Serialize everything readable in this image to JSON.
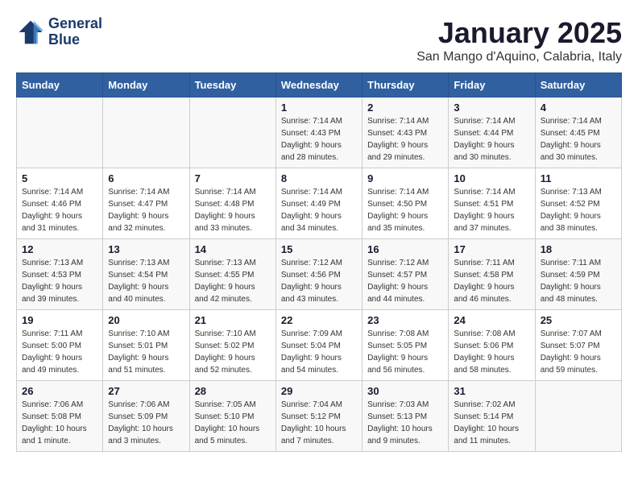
{
  "header": {
    "logo_line1": "General",
    "logo_line2": "Blue",
    "month": "January 2025",
    "location": "San Mango d'Aquino, Calabria, Italy"
  },
  "days_of_week": [
    "Sunday",
    "Monday",
    "Tuesday",
    "Wednesday",
    "Thursday",
    "Friday",
    "Saturday"
  ],
  "weeks": [
    [
      {
        "day": "",
        "info": ""
      },
      {
        "day": "",
        "info": ""
      },
      {
        "day": "",
        "info": ""
      },
      {
        "day": "1",
        "info": "Sunrise: 7:14 AM\nSunset: 4:43 PM\nDaylight: 9 hours\nand 28 minutes."
      },
      {
        "day": "2",
        "info": "Sunrise: 7:14 AM\nSunset: 4:43 PM\nDaylight: 9 hours\nand 29 minutes."
      },
      {
        "day": "3",
        "info": "Sunrise: 7:14 AM\nSunset: 4:44 PM\nDaylight: 9 hours\nand 30 minutes."
      },
      {
        "day": "4",
        "info": "Sunrise: 7:14 AM\nSunset: 4:45 PM\nDaylight: 9 hours\nand 30 minutes."
      }
    ],
    [
      {
        "day": "5",
        "info": "Sunrise: 7:14 AM\nSunset: 4:46 PM\nDaylight: 9 hours\nand 31 minutes."
      },
      {
        "day": "6",
        "info": "Sunrise: 7:14 AM\nSunset: 4:47 PM\nDaylight: 9 hours\nand 32 minutes."
      },
      {
        "day": "7",
        "info": "Sunrise: 7:14 AM\nSunset: 4:48 PM\nDaylight: 9 hours\nand 33 minutes."
      },
      {
        "day": "8",
        "info": "Sunrise: 7:14 AM\nSunset: 4:49 PM\nDaylight: 9 hours\nand 34 minutes."
      },
      {
        "day": "9",
        "info": "Sunrise: 7:14 AM\nSunset: 4:50 PM\nDaylight: 9 hours\nand 35 minutes."
      },
      {
        "day": "10",
        "info": "Sunrise: 7:14 AM\nSunset: 4:51 PM\nDaylight: 9 hours\nand 37 minutes."
      },
      {
        "day": "11",
        "info": "Sunrise: 7:13 AM\nSunset: 4:52 PM\nDaylight: 9 hours\nand 38 minutes."
      }
    ],
    [
      {
        "day": "12",
        "info": "Sunrise: 7:13 AM\nSunset: 4:53 PM\nDaylight: 9 hours\nand 39 minutes."
      },
      {
        "day": "13",
        "info": "Sunrise: 7:13 AM\nSunset: 4:54 PM\nDaylight: 9 hours\nand 40 minutes."
      },
      {
        "day": "14",
        "info": "Sunrise: 7:13 AM\nSunset: 4:55 PM\nDaylight: 9 hours\nand 42 minutes."
      },
      {
        "day": "15",
        "info": "Sunrise: 7:12 AM\nSunset: 4:56 PM\nDaylight: 9 hours\nand 43 minutes."
      },
      {
        "day": "16",
        "info": "Sunrise: 7:12 AM\nSunset: 4:57 PM\nDaylight: 9 hours\nand 44 minutes."
      },
      {
        "day": "17",
        "info": "Sunrise: 7:11 AM\nSunset: 4:58 PM\nDaylight: 9 hours\nand 46 minutes."
      },
      {
        "day": "18",
        "info": "Sunrise: 7:11 AM\nSunset: 4:59 PM\nDaylight: 9 hours\nand 48 minutes."
      }
    ],
    [
      {
        "day": "19",
        "info": "Sunrise: 7:11 AM\nSunset: 5:00 PM\nDaylight: 9 hours\nand 49 minutes."
      },
      {
        "day": "20",
        "info": "Sunrise: 7:10 AM\nSunset: 5:01 PM\nDaylight: 9 hours\nand 51 minutes."
      },
      {
        "day": "21",
        "info": "Sunrise: 7:10 AM\nSunset: 5:02 PM\nDaylight: 9 hours\nand 52 minutes."
      },
      {
        "day": "22",
        "info": "Sunrise: 7:09 AM\nSunset: 5:04 PM\nDaylight: 9 hours\nand 54 minutes."
      },
      {
        "day": "23",
        "info": "Sunrise: 7:08 AM\nSunset: 5:05 PM\nDaylight: 9 hours\nand 56 minutes."
      },
      {
        "day": "24",
        "info": "Sunrise: 7:08 AM\nSunset: 5:06 PM\nDaylight: 9 hours\nand 58 minutes."
      },
      {
        "day": "25",
        "info": "Sunrise: 7:07 AM\nSunset: 5:07 PM\nDaylight: 9 hours\nand 59 minutes."
      }
    ],
    [
      {
        "day": "26",
        "info": "Sunrise: 7:06 AM\nSunset: 5:08 PM\nDaylight: 10 hours\nand 1 minute."
      },
      {
        "day": "27",
        "info": "Sunrise: 7:06 AM\nSunset: 5:09 PM\nDaylight: 10 hours\nand 3 minutes."
      },
      {
        "day": "28",
        "info": "Sunrise: 7:05 AM\nSunset: 5:10 PM\nDaylight: 10 hours\nand 5 minutes."
      },
      {
        "day": "29",
        "info": "Sunrise: 7:04 AM\nSunset: 5:12 PM\nDaylight: 10 hours\nand 7 minutes."
      },
      {
        "day": "30",
        "info": "Sunrise: 7:03 AM\nSunset: 5:13 PM\nDaylight: 10 hours\nand 9 minutes."
      },
      {
        "day": "31",
        "info": "Sunrise: 7:02 AM\nSunset: 5:14 PM\nDaylight: 10 hours\nand 11 minutes."
      },
      {
        "day": "",
        "info": ""
      }
    ]
  ]
}
